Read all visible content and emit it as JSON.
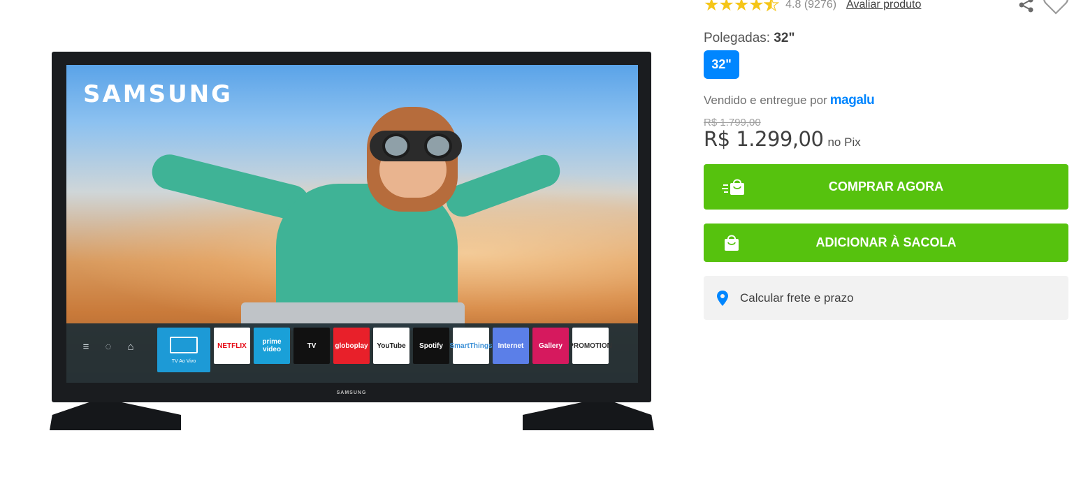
{
  "rating": {
    "stars_value": 4.8,
    "stars_max": 5,
    "score": "4.8",
    "count": "(9276)",
    "review_link": "Avaliar produto"
  },
  "actions": {
    "share_icon": "share-icon",
    "favorite_icon": "heart-icon"
  },
  "size": {
    "label": "Polegadas:",
    "selected": "32\"",
    "options": [
      "32\""
    ]
  },
  "seller": {
    "prefix": "Vendido e entregue por",
    "brand": "magalu"
  },
  "pricing": {
    "old_price": "R$ 1.799,00",
    "price": "R$ 1.299,00",
    "method": "no Pix"
  },
  "buttons": {
    "buy_now": "COMPRAR AGORA",
    "add_to_bag": "ADICIONAR À SACOLA"
  },
  "freight": {
    "label": "Calcular frete e prazo"
  },
  "product_image": {
    "screen_brand": "SAMSUNG",
    "bezel_brand": "SAMSUNG",
    "apps": [
      {
        "label": "TV Ao Vivo",
        "color": "#1d9ad6"
      },
      {
        "label": "NETFLIX",
        "color": "#ffffff",
        "text_color": "#e50914"
      },
      {
        "label": "prime video",
        "color": "#1aa0d8"
      },
      {
        "label": "TV",
        "color": "#111111"
      },
      {
        "label": "globoplay",
        "color": "#e8202a"
      },
      {
        "label": "YouTube",
        "color": "#ffffff",
        "text_color": "#222222"
      },
      {
        "label": "Spotify",
        "color": "#111111"
      },
      {
        "label": "SmartThings",
        "color": "#ffffff",
        "text_color": "#3a8fd6"
      },
      {
        "label": "Internet",
        "color": "#5b7fe8"
      },
      {
        "label": "Gallery",
        "color": "#d6195e"
      },
      {
        "label": "PROMOTION",
        "color": "#ffffff",
        "text_color": "#333333"
      }
    ]
  },
  "colors": {
    "accent_blue": "#0086ff",
    "cta_green": "#56c20e",
    "star_yellow": "#f5c518"
  }
}
